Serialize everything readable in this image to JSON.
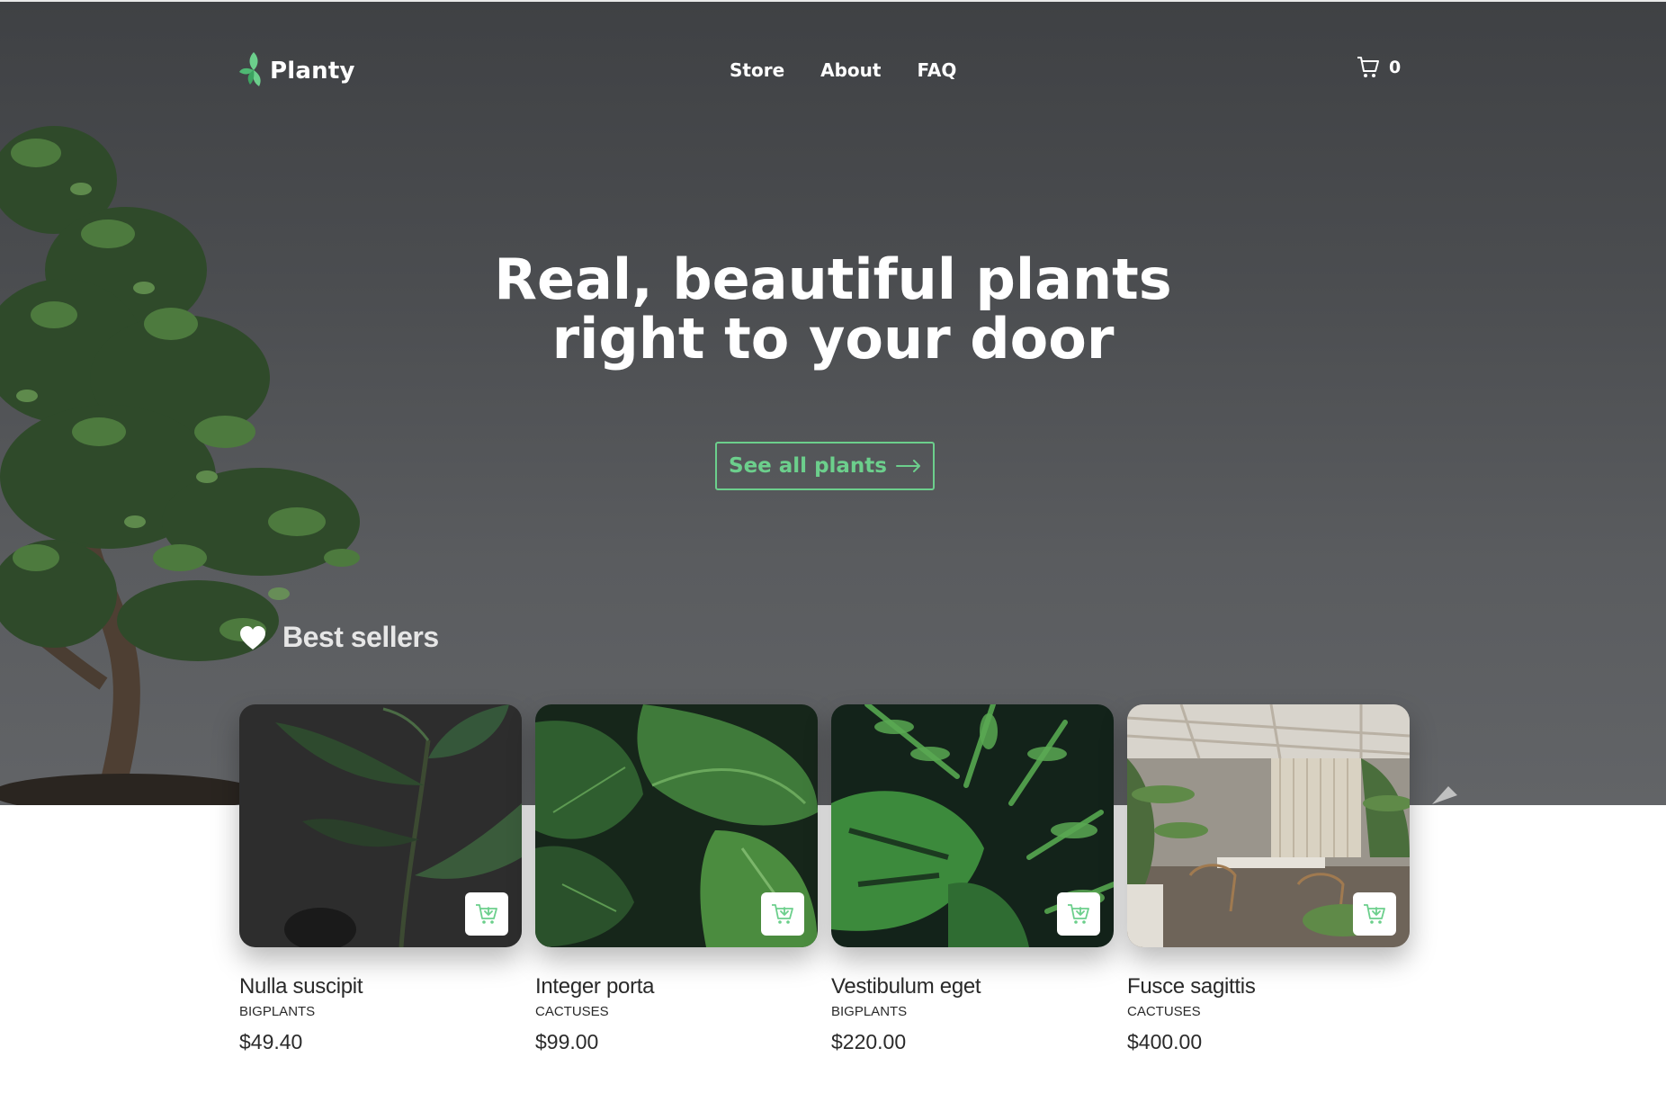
{
  "brand": {
    "name": "Planty",
    "icon": "leaf-icon",
    "accent": "#6ccf8c"
  },
  "nav": {
    "links": [
      "Store",
      "About",
      "FAQ"
    ]
  },
  "cart": {
    "icon": "cart-icon",
    "count": "0"
  },
  "hero": {
    "title_line1": "Real, beautiful plants",
    "title_line2": "right to your door",
    "cta_label": "See all plants",
    "cta_icon": "arrow-right-icon"
  },
  "best_sellers": {
    "title": "Best sellers",
    "icon": "heart-icon",
    "products": [
      {
        "name": "Nulla suscipit",
        "category": "BIGPLANTS",
        "price": "$49.40",
        "add_icon": "add-to-cart-icon"
      },
      {
        "name": "Integer porta",
        "category": "CACTUSES",
        "price": "$99.00",
        "add_icon": "add-to-cart-icon"
      },
      {
        "name": "Vestibulum eget",
        "category": "BIGPLANTS",
        "price": "$220.00",
        "add_icon": "add-to-cart-icon"
      },
      {
        "name": "Fusce sagittis",
        "category": "CACTUSES",
        "price": "$400.00",
        "add_icon": "add-to-cart-icon"
      }
    ]
  }
}
